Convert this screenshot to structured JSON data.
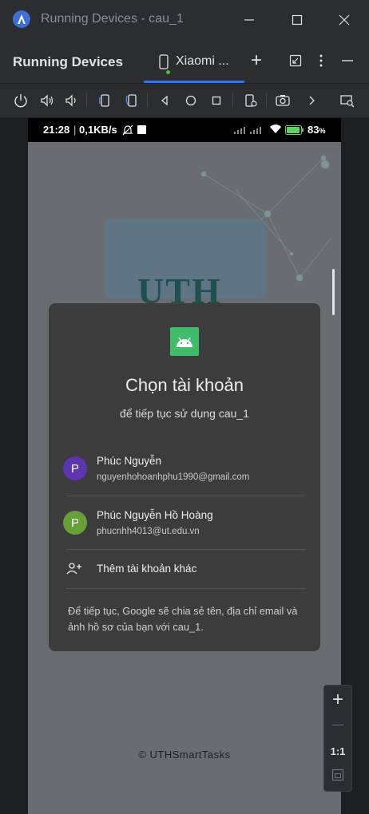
{
  "window": {
    "title": "Running Devices - cau_1"
  },
  "toolwindow": {
    "title": "Running Devices",
    "tab_label": "Xiaomi ...",
    "add_tab": "+"
  },
  "toolbar": {
    "icons": [
      "power-icon",
      "volume-up-icon",
      "volume-down-icon",
      "rotate-left-icon",
      "rotate-right-icon",
      "back-icon",
      "home-icon",
      "overview-icon",
      "device-settings-icon",
      "camera-icon",
      "more-chevron-icon",
      "device-explorer-icon"
    ]
  },
  "phone_status": {
    "time": "21:28",
    "speed": "0,1KB/s",
    "battery_pct": "83"
  },
  "app": {
    "logo_text": "UTH",
    "footer": "© UTHSmartTasks"
  },
  "dialog": {
    "title": "Chọn tài khoản",
    "subtitle": "để tiếp tục sử dụng cau_1",
    "accounts": [
      {
        "initial": "P",
        "name": "Phúc Nguyễn",
        "email": "nguyenhohoanhphu1990@gmail.com",
        "color": "#5e35b1"
      },
      {
        "initial": "P",
        "name": "Phúc Nguyễn Hồ Hoàng",
        "email": "phucnhh4013@ut.edu.vn",
        "color": "#689f38"
      }
    ],
    "add_account": "Thêm tài khoản khác",
    "note": "Để tiếp tục, Google sẽ chia sẻ tên, địa chỉ email và ảnh hồ sơ của bạn với cau_1."
  },
  "zoom": {
    "zoom_in": "+",
    "zoom_out": "—",
    "actual_size": "1:1"
  },
  "colors": {
    "accent": "#3574f0",
    "dialog_bg": "#3c3c3c",
    "android_green": "#3fbd6b"
  }
}
